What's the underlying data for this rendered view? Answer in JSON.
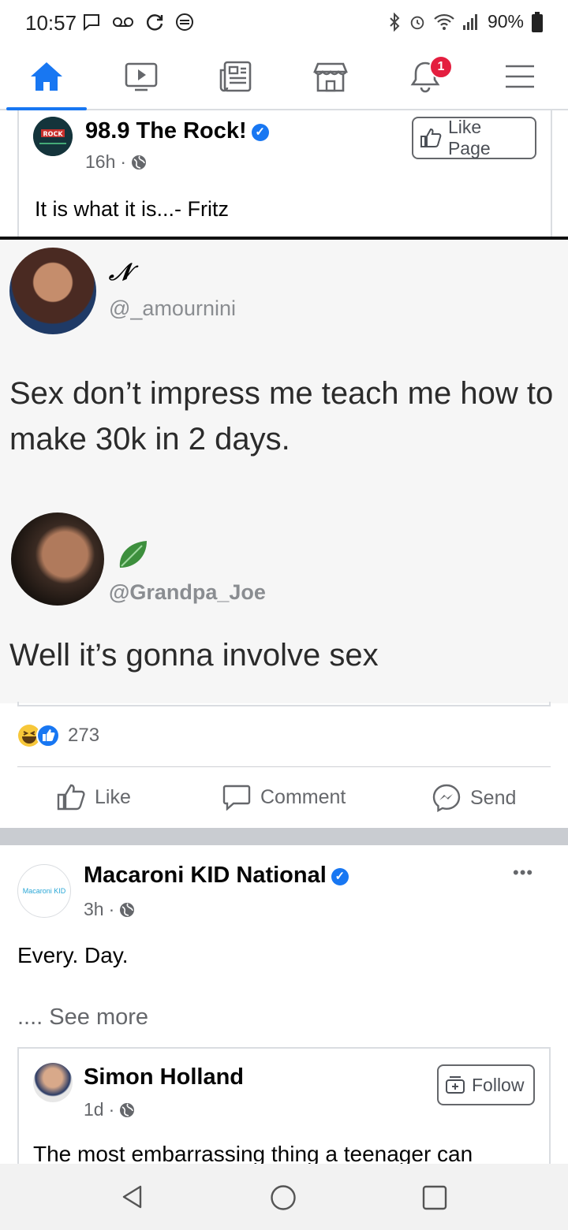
{
  "status": {
    "time": "10:57",
    "battery": "90%"
  },
  "nav": {
    "notification_count": "1"
  },
  "post1": {
    "page_name": "98.9 The Rock!",
    "time": "16h",
    "caption": "It is what it is...- Fritz",
    "like_page_label": "Like Page",
    "logo_text": "Rock!",
    "meme": {
      "tweet1_name": "𝒩",
      "tweet1_handle": "@_amournini",
      "tweet1_text": "Sex don’t impress me teach me how to make 30k in 2 days.",
      "tweet2_handle": "@Grandpa_Joe",
      "tweet2_text": "Well it’s gonna involve sex"
    },
    "reactions_count": "273",
    "actions": {
      "like": "Like",
      "comment": "Comment",
      "send": "Send"
    }
  },
  "post2": {
    "page_name": "Macaroni KID National",
    "logo_text": "Macaroni KID",
    "time": "3h",
    "text": "Every. Day.",
    "see_more": ".... See more",
    "more_menu": "•••",
    "shared": {
      "name": "Simon Holland",
      "time": "1d",
      "follow_label": "Follow",
      "text": "The most embarrassing thing a teenager can"
    }
  },
  "colors": {
    "brand": "#1877f2",
    "badge": "#e41e3f",
    "muted": "#65676b"
  }
}
